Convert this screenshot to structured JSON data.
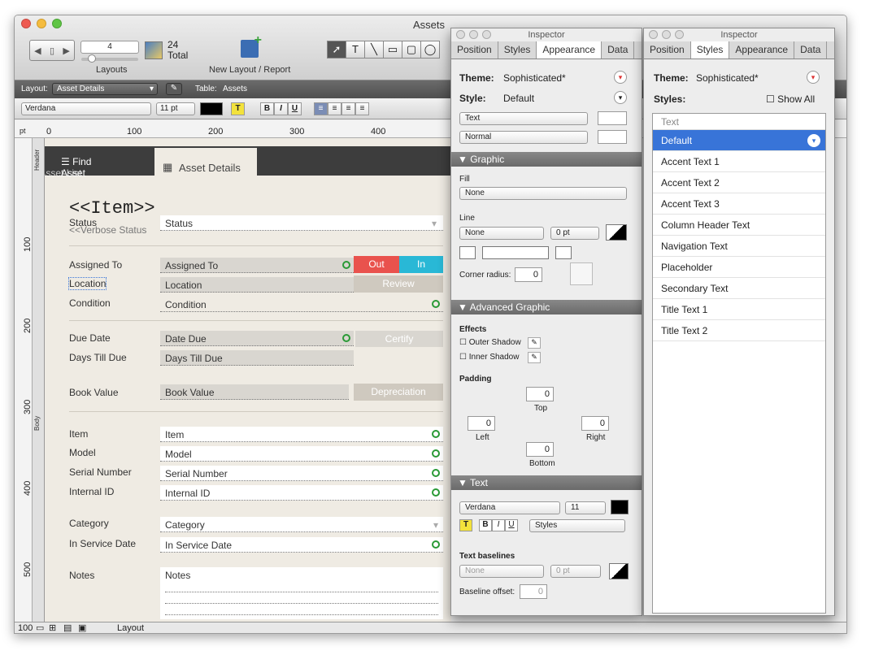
{
  "window": {
    "title": "Assets"
  },
  "toolbar": {
    "record": "4",
    "layouts_label": "Layouts",
    "total_count": "24",
    "total_label": "Total",
    "new_layout_label": "New Layout / Report"
  },
  "layout_bar": {
    "layout_label": "Layout:",
    "layout_value": "Asset Details",
    "table_label": "Table:",
    "table_value": "Assets"
  },
  "format_bar": {
    "font": "Verdana",
    "size": "11 pt",
    "bold": "B",
    "italic": "I",
    "underline": "U",
    "highlight": "T"
  },
  "ruler": {
    "unit": "pt",
    "h_ticks": [
      "0",
      "100",
      "200",
      "300",
      "400"
    ],
    "v_ticks": [
      "100",
      "200",
      "300",
      "400",
      "500"
    ]
  },
  "parts": {
    "header": "Header",
    "body": "Body"
  },
  "canvas": {
    "tab_list": "Find Asset",
    "tab_list_overlay": "Asset List",
    "tab_details": "Asset Details",
    "title": "<<Item>>",
    "verbose": "<<Verbose Status",
    "status_label": "Status",
    "status_value": "Status",
    "assigned_label": "Assigned To",
    "assigned_value": "Assigned To",
    "btn_out": "Out",
    "btn_in": "In",
    "location_label": "Location",
    "location_value": "Location",
    "btn_review": "Review",
    "condition_label": "Condition",
    "condition_value": "Condition",
    "due_label": "Due Date",
    "due_value": "Date Due",
    "btn_certify": "Certify",
    "days_label": "Days Till Due",
    "days_value": "Days Till Due",
    "book_label": "Book Value",
    "book_value": "Book Value",
    "btn_depreciation": "Depreciation",
    "item_label": "Item",
    "item_value": "Item",
    "model_label": "Model",
    "model_value": "Model",
    "serial_label": "Serial Number",
    "serial_value": "Serial Number",
    "internal_label": "Internal ID",
    "internal_value": "Internal ID",
    "category_label": "Category",
    "category_value": "Category",
    "service_label": "In Service Date",
    "service_value": "In Service Date",
    "notes_label": "Notes",
    "notes_value": "Notes"
  },
  "status_bar": {
    "zoom": "100",
    "mode": "Layout"
  },
  "inspector1": {
    "title": "Inspector",
    "tabs": [
      "Position",
      "Styles",
      "Appearance",
      "Data"
    ],
    "theme_label": "Theme:",
    "theme_value": "Sophisticated*",
    "style_label": "Style:",
    "style_value": "Default",
    "obj_type": "Text",
    "obj_state": "Normal",
    "graphic": "Graphic",
    "fill_label": "Fill",
    "fill_value": "None",
    "line_label": "Line",
    "line_value": "None",
    "line_width": "0 pt",
    "corner_label": "Corner radius:",
    "corner_value": "0",
    "adv_graphic": "Advanced Graphic",
    "effects_label": "Effects",
    "outer_shadow": "Outer Shadow",
    "inner_shadow": "Inner Shadow",
    "padding_label": "Padding",
    "pad_top": "0",
    "pad_left": "0",
    "pad_right": "0",
    "pad_bottom": "0",
    "top": "Top",
    "left": "Left",
    "right": "Right",
    "bottom": "Bottom",
    "text_section": "Text",
    "font": "Verdana",
    "size": "11",
    "styles_btn": "Styles",
    "baselines_label": "Text baselines",
    "baseline_value": "None",
    "baseline_width": "0 pt",
    "baseline_offset_label": "Baseline offset:",
    "baseline_offset": "0"
  },
  "inspector2": {
    "title": "Inspector",
    "tabs": [
      "Position",
      "Styles",
      "Appearance",
      "Data"
    ],
    "theme_label": "Theme:",
    "theme_value": "Sophisticated*",
    "styles_label": "Styles:",
    "show_all": "Show All",
    "list_header": "Text",
    "styles": [
      "Default",
      "Accent Text 1",
      "Accent Text 2",
      "Accent Text 3",
      "Column Header Text",
      "Navigation Text",
      "Placeholder",
      "Secondary Text",
      "Title Text 1",
      "Title Text 2"
    ]
  },
  "colors": {
    "accent": "#3874d8",
    "out": "#e9524d",
    "in": "#29b8d6",
    "panel_header": "#6f6f6f",
    "canvas": "#efebe3"
  }
}
